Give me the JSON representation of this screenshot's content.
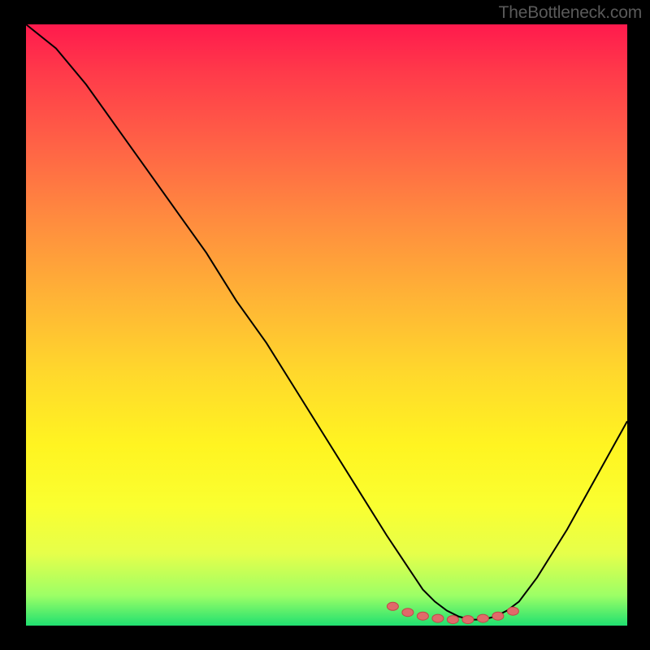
{
  "watermark": "TheBottleneck.com",
  "chart_data": {
    "type": "line",
    "title": "",
    "xlabel": "",
    "ylabel": "",
    "xlim": [
      0,
      100
    ],
    "ylim": [
      0,
      100
    ],
    "series": [
      {
        "name": "bottleneck-curve",
        "x": [
          0,
          5,
          10,
          15,
          20,
          25,
          30,
          35,
          40,
          45,
          50,
          55,
          60,
          62,
          64,
          66,
          68,
          70,
          72,
          74,
          76,
          78,
          80,
          82,
          85,
          90,
          95,
          100
        ],
        "y": [
          100,
          96,
          90,
          83,
          76,
          69,
          62,
          54,
          47,
          39,
          31,
          23,
          15,
          12,
          9,
          6,
          4,
          2.5,
          1.5,
          1,
          1,
          1.5,
          2.5,
          4,
          8,
          16,
          25,
          34
        ]
      }
    ],
    "markers": {
      "name": "highlight-dots",
      "x": [
        61,
        63.5,
        66,
        68.5,
        71,
        73.5,
        76,
        78.5,
        81
      ],
      "y": [
        3.2,
        2.2,
        1.6,
        1.2,
        1.0,
        1.0,
        1.2,
        1.6,
        2.4
      ]
    },
    "background_gradient": {
      "top": "#ff1a4d",
      "mid": "#fff421",
      "bottom": "#20e070"
    }
  }
}
